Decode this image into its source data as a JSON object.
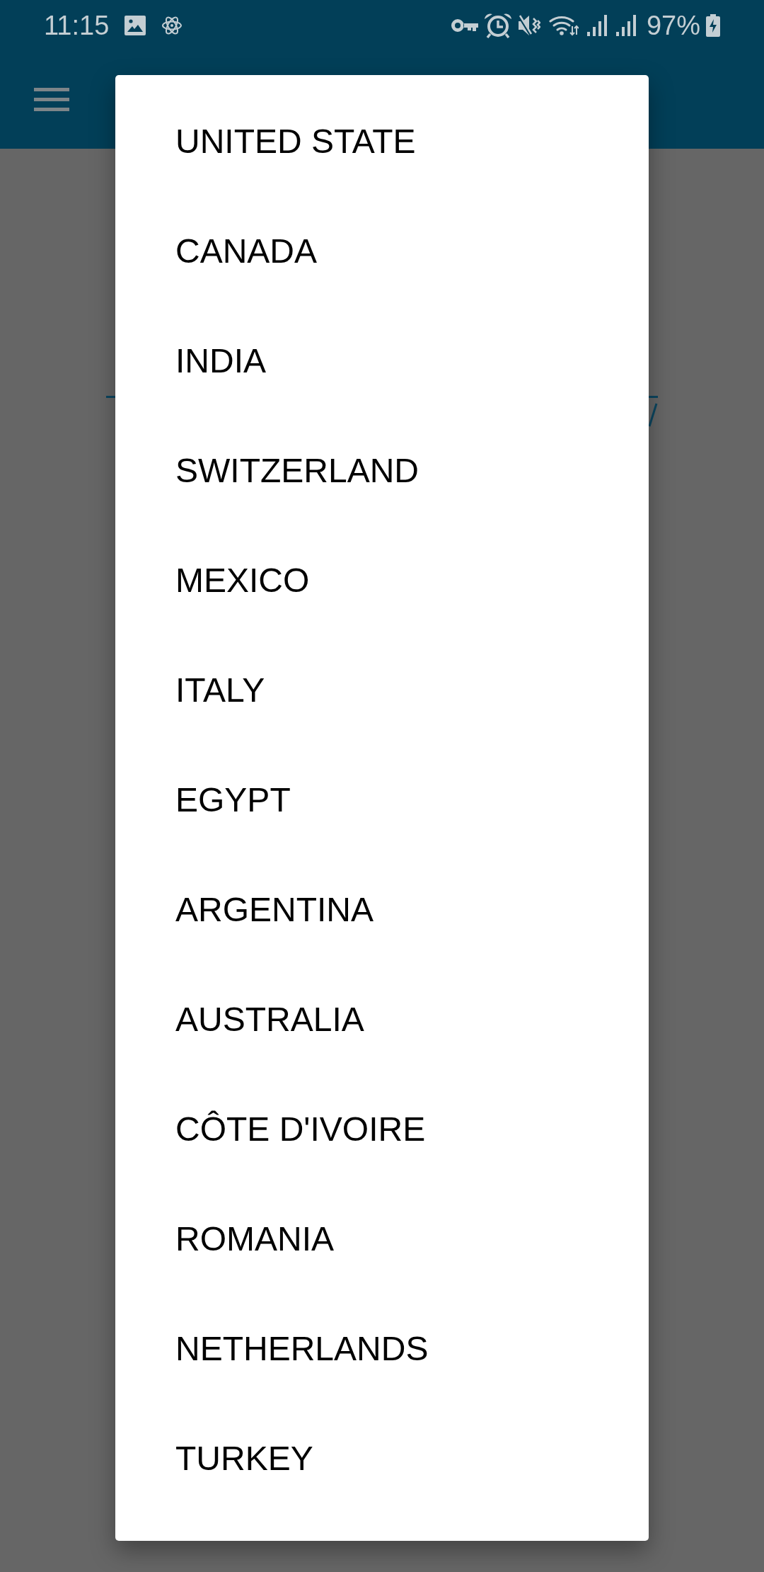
{
  "status_bar": {
    "time": "11:15",
    "battery": "97%"
  },
  "dropdown": {
    "items": [
      {
        "label": "UNITED STATE",
        "selected": false
      },
      {
        "label": "CANADA",
        "selected": false
      },
      {
        "label": "INDIA",
        "selected": false
      },
      {
        "label": "SWITZERLAND",
        "selected": false
      },
      {
        "label": "MEXICO",
        "selected": false
      },
      {
        "label": "ITALY",
        "selected": false
      },
      {
        "label": "EGYPT",
        "selected": false
      },
      {
        "label": "ARGENTINA",
        "selected": false
      },
      {
        "label": "AUSTRALIA",
        "selected": false
      },
      {
        "label": "CÔTE D'IVOIRE",
        "selected": false
      },
      {
        "label": "ROMANIA",
        "selected": false
      },
      {
        "label": "NETHERLANDS",
        "selected": false
      },
      {
        "label": "TURKEY",
        "selected": false
      }
    ]
  }
}
